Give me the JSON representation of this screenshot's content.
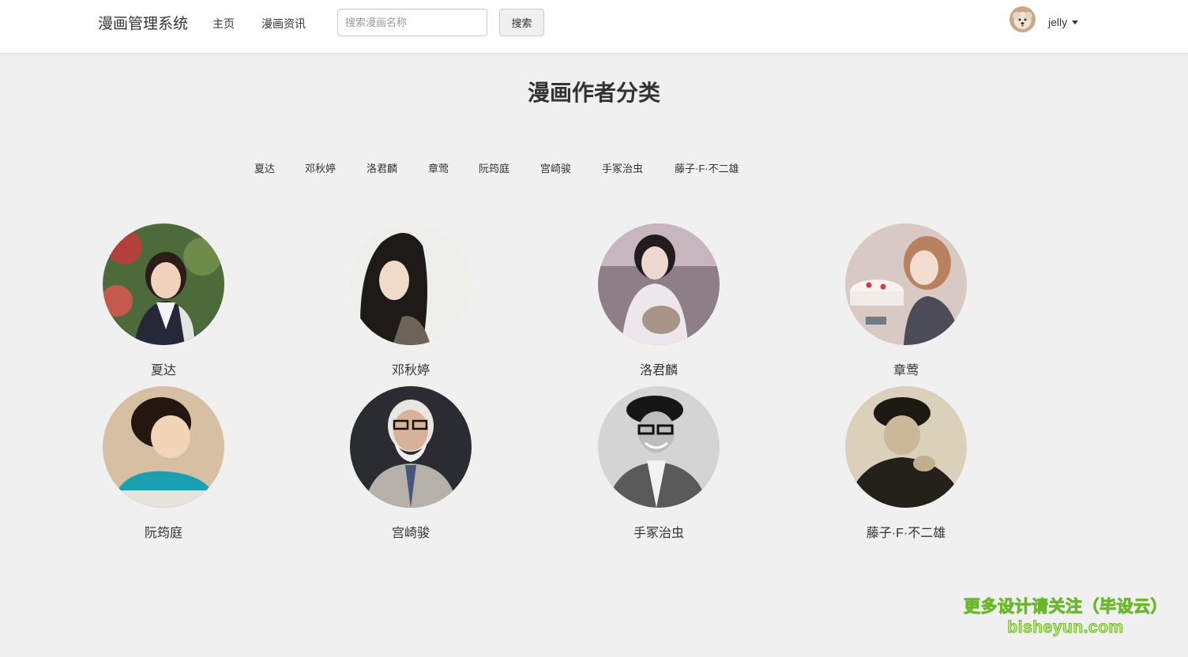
{
  "navbar": {
    "brand": "漫画管理系统",
    "links": [
      "主页",
      "漫画资讯"
    ],
    "search": {
      "placeholder": "搜索漫画名称",
      "value": "",
      "button_label": "搜索"
    },
    "user": {
      "name": "jelly"
    }
  },
  "page": {
    "title": "漫画作者分类"
  },
  "categories": [
    "夏达",
    "邓秋婷",
    "洛君麟",
    "章莺",
    "阮筠庭",
    "宫崎骏",
    "手冢治虫",
    "藤子·F·不二雄"
  ],
  "authors": [
    {
      "name": "夏达"
    },
    {
      "name": "邓秋婷"
    },
    {
      "name": "洛君麟"
    },
    {
      "name": "章莺"
    },
    {
      "name": "阮筠庭"
    },
    {
      "name": "宫崎骏"
    },
    {
      "name": "手冢治虫"
    },
    {
      "name": "藤子·F·不二雄"
    }
  ],
  "watermark": {
    "line1": "更多设计请关注（毕设云）",
    "line2": "bisheyun.com"
  },
  "icons": {
    "dropdown": "caret-down-icon"
  }
}
